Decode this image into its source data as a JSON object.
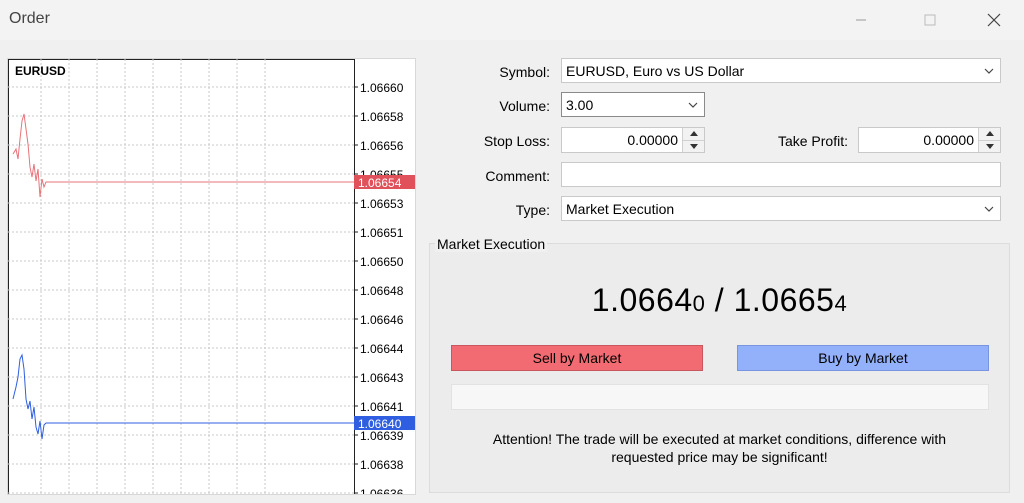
{
  "window": {
    "title": "Order"
  },
  "chart": {
    "symbol": "EURUSD",
    "price_labels": [
      "1.06660",
      "1.06658",
      "1.06656",
      "1.06655",
      "1.06653",
      "1.06651",
      "1.06650",
      "1.06648",
      "1.06646",
      "1.06644",
      "1.06643",
      "1.06641",
      "1.06639",
      "1.06638",
      "1.06636"
    ],
    "ask_tag": "1.06654",
    "bid_tag": "1.06640",
    "colors": {
      "ask": "#e8737a",
      "bid": "#2f5fe0"
    }
  },
  "form": {
    "symbol_label": "Symbol:",
    "symbol_value": "EURUSD, Euro vs US Dollar",
    "volume_label": "Volume:",
    "volume_value": "3.00",
    "stoploss_label": "Stop Loss:",
    "stoploss_value": "0.00000",
    "takeprofit_label": "Take Profit:",
    "takeprofit_value": "0.00000",
    "comment_label": "Comment:",
    "comment_value": "",
    "type_label": "Type:",
    "type_value": "Market Execution"
  },
  "execution": {
    "group_title": "Market Execution",
    "bid_main": "1.0664",
    "bid_small": "0",
    "separator": " / ",
    "ask_main": "1.0665",
    "ask_small": "4",
    "sell_label": "Sell by Market",
    "buy_label": "Buy by Market",
    "attention_line1": "Attention! The trade will be executed at market conditions, difference with",
    "attention_line2": "requested price may be significant!",
    "colors": {
      "sell": "#f26b73",
      "buy": "#93b1fb"
    }
  }
}
